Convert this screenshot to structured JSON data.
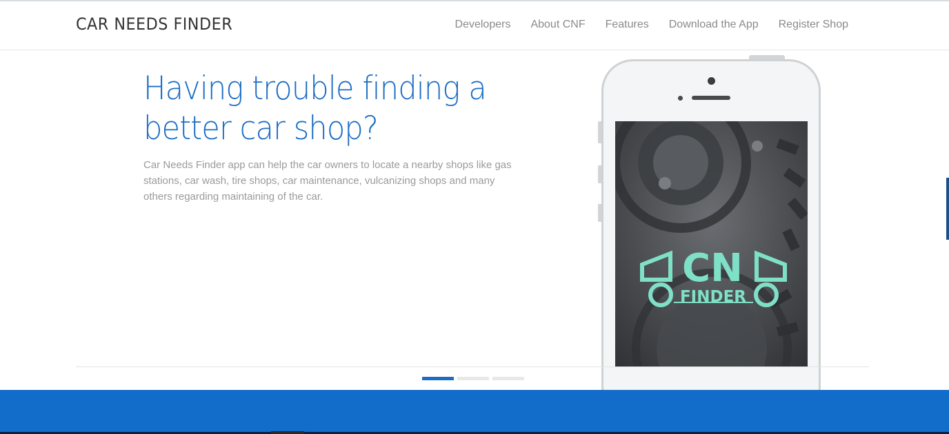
{
  "header": {
    "brand": "CAR NEEDS FINDER",
    "nav": [
      "Developers",
      "About CNF",
      "Features",
      "Download the App",
      "Register Shop"
    ]
  },
  "hero": {
    "title_line1": "Having trouble finding a",
    "title_line2": "better car shop?",
    "description": "Car Needs Finder app can help the car owners to locate a nearby shops like gas stations, car wash, tire shops, car maintenance, vulcanizing shops and many others regarding maintaining of the car."
  },
  "app_logo": {
    "text_top": "CN",
    "text_bottom": "FINDER",
    "color": "#7fe0c8"
  },
  "carousel": {
    "slide_count": 3,
    "active_index": 0
  },
  "colors": {
    "accent": "#1b6dc4",
    "band": "#126dca"
  }
}
